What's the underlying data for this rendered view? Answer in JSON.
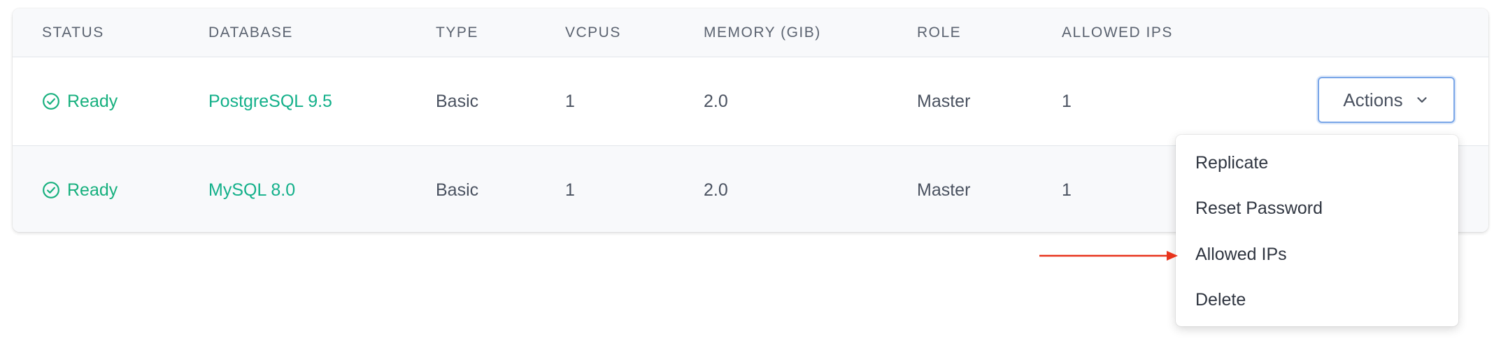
{
  "table": {
    "headers": {
      "status": "STATUS",
      "database": "DATABASE",
      "type": "TYPE",
      "vcpus": "VCPUS",
      "memory": "MEMORY (GIB)",
      "role": "ROLE",
      "allowed_ips": "ALLOWED IPS"
    },
    "rows": [
      {
        "status": "Ready",
        "database": "PostgreSQL 9.5",
        "type": "Basic",
        "vcpus": "1",
        "memory": "2.0",
        "role": "Master",
        "allowed_ips": "1"
      },
      {
        "status": "Ready",
        "database": "MySQL 8.0",
        "type": "Basic",
        "vcpus": "1",
        "memory": "2.0",
        "role": "Master",
        "allowed_ips": "1"
      }
    ]
  },
  "actions": {
    "label": "Actions",
    "menu": [
      "Replicate",
      "Reset Password",
      "Allowed IPs",
      "Delete"
    ]
  },
  "icons": {
    "status": "check-circle-icon",
    "actions": "chevron-down-icon",
    "annotation": "red-arrow-icon"
  },
  "colors": {
    "status_green": "#17b07e",
    "link_green": "#13b08a",
    "focus_blue": "#7aa6e8",
    "annotation_red": "#e8341c"
  }
}
